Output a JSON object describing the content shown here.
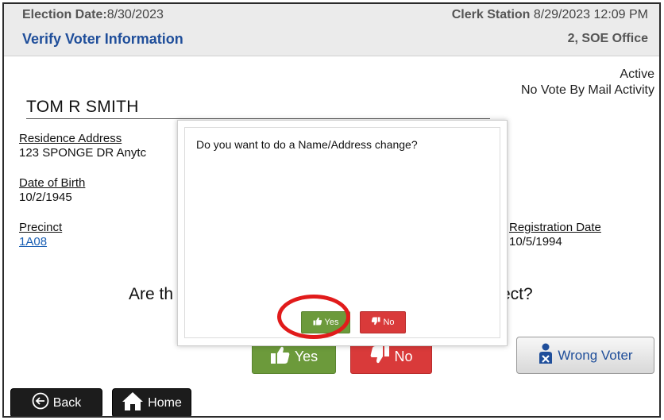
{
  "header": {
    "election_label": "Election Date:",
    "election_date": "8/30/2023",
    "title": "Verify Voter Information",
    "station_label": "Clerk Station",
    "station_datetime": "8/29/2023 12:09 PM",
    "office": "2, SOE Office"
  },
  "status": {
    "active": "Active",
    "vote_by_mail": "No Vote By Mail Activity"
  },
  "voter": {
    "name": "TOM R SMITH",
    "residence_label": "Residence Address",
    "residence_value": "123 SPONGE DR Anytc",
    "dob_label": "Date of Birth",
    "dob_value": "10/2/1945",
    "precinct_label": "Precinct",
    "precinct_value": "1A08",
    "registration_label": "Registration Date",
    "registration_value": "10/5/1994"
  },
  "question": {
    "left_fragment": "Are th",
    "right_fragment": "rrect?"
  },
  "buttons": {
    "yes": "Yes",
    "no": "No",
    "wrong_voter": "Wrong Voter",
    "back": "Back",
    "home": "Home"
  },
  "modal": {
    "prompt": "Do you want to do a Name/Address change?",
    "yes": "Yes",
    "no": "No"
  },
  "colors": {
    "header_title": "#1f4e9a",
    "yes_green": "#6c9a3b",
    "no_red": "#d93a3a",
    "highlight_ring": "#e11b1b"
  }
}
